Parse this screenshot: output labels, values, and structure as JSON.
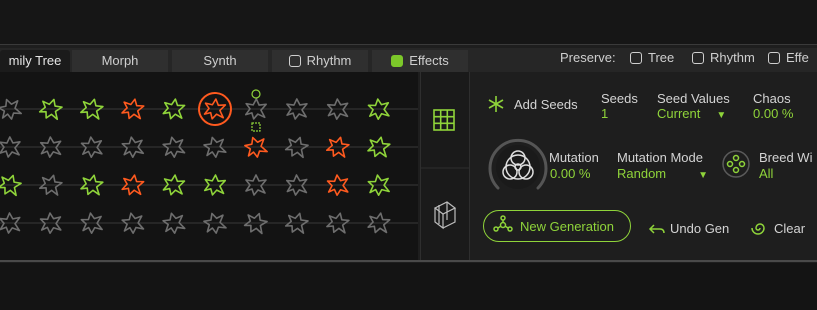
{
  "tabs": [
    {
      "label": "mily Tree",
      "active": true
    },
    {
      "label": "Morph"
    },
    {
      "label": "Synth"
    },
    {
      "label": "Rhythm",
      "checkbox": true,
      "checked": false
    },
    {
      "label": "Effects",
      "checkbox": true,
      "checked": true
    }
  ],
  "preserve": {
    "label": "Preserve:",
    "options": [
      {
        "label": "Tree",
        "checked": false
      },
      {
        "label": "Rhythm",
        "checked": false
      },
      {
        "label": "Effe",
        "checked": false
      }
    ]
  },
  "controls": {
    "add_seeds": "Add Seeds",
    "seeds": {
      "label": "Seeds",
      "value": "1"
    },
    "seed_values": {
      "label": "Seed Values",
      "value": "Current"
    },
    "chaos": {
      "label": "Chaos",
      "value": "0.00 %"
    },
    "mutation": {
      "label": "Mutation",
      "value": "0.00 %"
    },
    "mutation_mode": {
      "label": "Mutation Mode",
      "value": "Random"
    },
    "breed_with": {
      "label": "Breed Wi",
      "value": "All"
    },
    "new_generation": "New Generation",
    "undo_gen": "Undo Gen",
    "clear": "Clear"
  },
  "grid_rows": [
    [
      "gray",
      "green",
      "green",
      "orange",
      "green",
      "selected",
      "gray",
      "gray",
      "gray",
      "green"
    ],
    [
      "gray",
      "gray",
      "gray",
      "gray",
      "gray",
      "gray",
      "orange",
      "gray",
      "orange",
      "green"
    ],
    [
      "green",
      "gray",
      "green",
      "orange",
      "green",
      "green",
      "gray",
      "gray",
      "orange",
      "green"
    ],
    [
      "gray",
      "gray",
      "gray",
      "gray",
      "gray",
      "gray",
      "gray",
      "gray",
      "gray",
      "gray"
    ]
  ],
  "colors": {
    "accent_green": "#8fd43a",
    "accent_orange": "#ff5a1f",
    "icon_gray": "#6e6e6e"
  }
}
